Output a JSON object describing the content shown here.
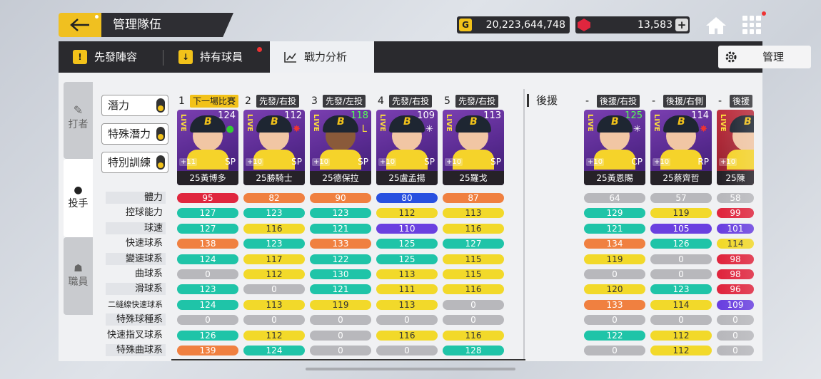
{
  "header": {
    "title": "管理隊伍",
    "gold": "20,223,644,748",
    "gems": "13,583",
    "gold_icon": "G"
  },
  "tabs": {
    "starting": "先發陣容",
    "owned": "持有球員",
    "analysis": "戰力分析",
    "manage": "管理",
    "tab_icon_1": "!",
    "tab_icon_2": "↓"
  },
  "sidenav": {
    "batter": "打者",
    "pitcher": "投手",
    "staff": "職員"
  },
  "sidebtns": {
    "potential": "潛力",
    "special_potential": "特殊潛力",
    "special_training": "特別訓練"
  },
  "bench_label": "後援",
  "pitchers": [
    {
      "num": "1",
      "role": "下一場比賽",
      "ovr": "124",
      "name": "25黃博多",
      "pos": "SP",
      "lv": "+11",
      "mark": "●",
      "mark_color": "#3c3"
    },
    {
      "num": "2",
      "role": "先發/右投",
      "ovr": "112",
      "name": "25勝騎士",
      "pos": "SP",
      "lv": "+10",
      "mark": "✸",
      "mark_color": "#e33"
    },
    {
      "num": "3",
      "role": "先發/左投",
      "ovr": "118",
      "name": "25德保拉",
      "pos": "SP",
      "lv": "+10",
      "mark": "L",
      "mark_color": "#ffe23a",
      "dark": true,
      "green": true
    },
    {
      "num": "4",
      "role": "先發/右投",
      "ovr": "109",
      "name": "25盧孟揚",
      "pos": "SP",
      "lv": "+10",
      "mark": "✳",
      "mark_color": "#fff"
    },
    {
      "num": "5",
      "role": "先發/右投",
      "ovr": "113",
      "name": "25羅戈",
      "pos": "SP",
      "lv": "+10",
      "mark": "",
      "mark_color": "#fff"
    },
    {
      "num": "-",
      "role": "後援/右投",
      "ovr": "125",
      "name": "25黃恩賜",
      "pos": "CP",
      "lv": "+10",
      "mark": "✳",
      "mark_color": "#fff",
      "green": true
    },
    {
      "num": "-",
      "role": "後援/右側",
      "ovr": "114",
      "name": "25蔡齊哲",
      "pos": "RP",
      "lv": "+10",
      "mark": "✸",
      "mark_color": "#e33"
    },
    {
      "num": "-",
      "role": "後援",
      "ovr": "",
      "name": "25陳",
      "pos": "",
      "lv": "+10",
      "mark": "",
      "mark_color": "#fff"
    }
  ],
  "stat_labels": [
    "體力",
    "控球能力",
    "球速",
    "快速球系",
    "變速球系",
    "曲球系",
    "滑球系",
    "二縫線快速球系",
    "特殊球種系",
    "快速指叉球系",
    "特殊曲球系"
  ],
  "stats": [
    [
      [
        "95",
        "R"
      ],
      [
        "82",
        "O"
      ],
      [
        "90",
        "O"
      ],
      [
        "80",
        "B"
      ],
      [
        "87",
        "O"
      ],
      [
        "64",
        "G"
      ],
      [
        "57",
        "G"
      ],
      [
        "58",
        "G"
      ]
    ],
    [
      [
        "127",
        "T"
      ],
      [
        "123",
        "T"
      ],
      [
        "123",
        "T"
      ],
      [
        "112",
        "Y"
      ],
      [
        "113",
        "Y"
      ],
      [
        "129",
        "T"
      ],
      [
        "119",
        "Y"
      ],
      [
        "99",
        "R"
      ]
    ],
    [
      [
        "127",
        "T"
      ],
      [
        "116",
        "Y"
      ],
      [
        "121",
        "T"
      ],
      [
        "110",
        "P"
      ],
      [
        "116",
        "Y"
      ],
      [
        "121",
        "T"
      ],
      [
        "105",
        "P"
      ],
      [
        "101",
        "P"
      ]
    ],
    [
      [
        "138",
        "O"
      ],
      [
        "123",
        "T"
      ],
      [
        "133",
        "O"
      ],
      [
        "125",
        "T"
      ],
      [
        "127",
        "T"
      ],
      [
        "134",
        "O"
      ],
      [
        "126",
        "T"
      ],
      [
        "114",
        "Y"
      ]
    ],
    [
      [
        "124",
        "T"
      ],
      [
        "117",
        "Y"
      ],
      [
        "122",
        "T"
      ],
      [
        "125",
        "T"
      ],
      [
        "115",
        "Y"
      ],
      [
        "119",
        "Y"
      ],
      [
        "0",
        "G"
      ],
      [
        "98",
        "R"
      ]
    ],
    [
      [
        "0",
        "G"
      ],
      [
        "112",
        "Y"
      ],
      [
        "130",
        "T"
      ],
      [
        "113",
        "Y"
      ],
      [
        "115",
        "Y"
      ],
      [
        "0",
        "G"
      ],
      [
        "0",
        "G"
      ],
      [
        "98",
        "R"
      ]
    ],
    [
      [
        "123",
        "T"
      ],
      [
        "0",
        "G"
      ],
      [
        "121",
        "T"
      ],
      [
        "111",
        "Y"
      ],
      [
        "116",
        "Y"
      ],
      [
        "120",
        "Y"
      ],
      [
        "123",
        "T"
      ],
      [
        "96",
        "R"
      ]
    ],
    [
      [
        "124",
        "T"
      ],
      [
        "113",
        "Y"
      ],
      [
        "119",
        "Y"
      ],
      [
        "113",
        "Y"
      ],
      [
        "0",
        "G"
      ],
      [
        "133",
        "O"
      ],
      [
        "114",
        "Y"
      ],
      [
        "109",
        "P"
      ]
    ],
    [
      [
        "0",
        "G"
      ],
      [
        "0",
        "G"
      ],
      [
        "0",
        "G"
      ],
      [
        "0",
        "G"
      ],
      [
        "0",
        "G"
      ],
      [
        "0",
        "G"
      ],
      [
        "0",
        "G"
      ],
      [
        "0",
        "G"
      ]
    ],
    [
      [
        "126",
        "T"
      ],
      [
        "112",
        "Y"
      ],
      [
        "0",
        "G"
      ],
      [
        "116",
        "Y"
      ],
      [
        "116",
        "Y"
      ],
      [
        "122",
        "T"
      ],
      [
        "112",
        "Y"
      ],
      [
        "0",
        "G"
      ]
    ],
    [
      [
        "139",
        "O"
      ],
      [
        "124",
        "T"
      ],
      [
        "0",
        "G"
      ],
      [
        "0",
        "G"
      ],
      [
        "128",
        "T"
      ],
      [
        "0",
        "G"
      ],
      [
        "112",
        "Y"
      ],
      [
        "0",
        "G"
      ]
    ]
  ]
}
